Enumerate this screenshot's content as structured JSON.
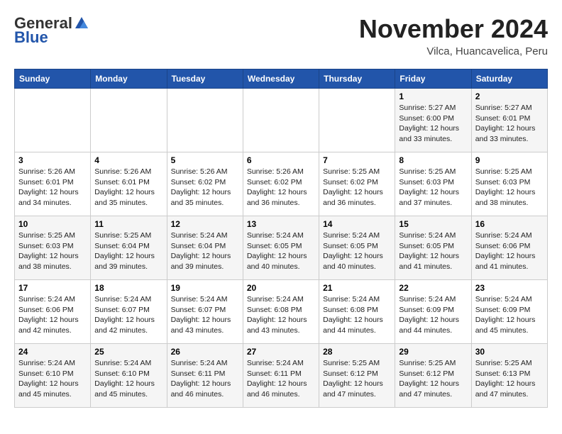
{
  "header": {
    "logo_general": "General",
    "logo_blue": "Blue",
    "month_title": "November 2024",
    "location": "Vilca, Huancavelica, Peru"
  },
  "weekdays": [
    "Sunday",
    "Monday",
    "Tuesday",
    "Wednesday",
    "Thursday",
    "Friday",
    "Saturday"
  ],
  "weeks": [
    [
      {
        "day": "",
        "info": ""
      },
      {
        "day": "",
        "info": ""
      },
      {
        "day": "",
        "info": ""
      },
      {
        "day": "",
        "info": ""
      },
      {
        "day": "",
        "info": ""
      },
      {
        "day": "1",
        "info": "Sunrise: 5:27 AM\nSunset: 6:00 PM\nDaylight: 12 hours and 33 minutes."
      },
      {
        "day": "2",
        "info": "Sunrise: 5:27 AM\nSunset: 6:01 PM\nDaylight: 12 hours and 33 minutes."
      }
    ],
    [
      {
        "day": "3",
        "info": "Sunrise: 5:26 AM\nSunset: 6:01 PM\nDaylight: 12 hours and 34 minutes."
      },
      {
        "day": "4",
        "info": "Sunrise: 5:26 AM\nSunset: 6:01 PM\nDaylight: 12 hours and 35 minutes."
      },
      {
        "day": "5",
        "info": "Sunrise: 5:26 AM\nSunset: 6:02 PM\nDaylight: 12 hours and 35 minutes."
      },
      {
        "day": "6",
        "info": "Sunrise: 5:26 AM\nSunset: 6:02 PM\nDaylight: 12 hours and 36 minutes."
      },
      {
        "day": "7",
        "info": "Sunrise: 5:25 AM\nSunset: 6:02 PM\nDaylight: 12 hours and 36 minutes."
      },
      {
        "day": "8",
        "info": "Sunrise: 5:25 AM\nSunset: 6:03 PM\nDaylight: 12 hours and 37 minutes."
      },
      {
        "day": "9",
        "info": "Sunrise: 5:25 AM\nSunset: 6:03 PM\nDaylight: 12 hours and 38 minutes."
      }
    ],
    [
      {
        "day": "10",
        "info": "Sunrise: 5:25 AM\nSunset: 6:03 PM\nDaylight: 12 hours and 38 minutes."
      },
      {
        "day": "11",
        "info": "Sunrise: 5:25 AM\nSunset: 6:04 PM\nDaylight: 12 hours and 39 minutes."
      },
      {
        "day": "12",
        "info": "Sunrise: 5:24 AM\nSunset: 6:04 PM\nDaylight: 12 hours and 39 minutes."
      },
      {
        "day": "13",
        "info": "Sunrise: 5:24 AM\nSunset: 6:05 PM\nDaylight: 12 hours and 40 minutes."
      },
      {
        "day": "14",
        "info": "Sunrise: 5:24 AM\nSunset: 6:05 PM\nDaylight: 12 hours and 40 minutes."
      },
      {
        "day": "15",
        "info": "Sunrise: 5:24 AM\nSunset: 6:05 PM\nDaylight: 12 hours and 41 minutes."
      },
      {
        "day": "16",
        "info": "Sunrise: 5:24 AM\nSunset: 6:06 PM\nDaylight: 12 hours and 41 minutes."
      }
    ],
    [
      {
        "day": "17",
        "info": "Sunrise: 5:24 AM\nSunset: 6:06 PM\nDaylight: 12 hours and 42 minutes."
      },
      {
        "day": "18",
        "info": "Sunrise: 5:24 AM\nSunset: 6:07 PM\nDaylight: 12 hours and 42 minutes."
      },
      {
        "day": "19",
        "info": "Sunrise: 5:24 AM\nSunset: 6:07 PM\nDaylight: 12 hours and 43 minutes."
      },
      {
        "day": "20",
        "info": "Sunrise: 5:24 AM\nSunset: 6:08 PM\nDaylight: 12 hours and 43 minutes."
      },
      {
        "day": "21",
        "info": "Sunrise: 5:24 AM\nSunset: 6:08 PM\nDaylight: 12 hours and 44 minutes."
      },
      {
        "day": "22",
        "info": "Sunrise: 5:24 AM\nSunset: 6:09 PM\nDaylight: 12 hours and 44 minutes."
      },
      {
        "day": "23",
        "info": "Sunrise: 5:24 AM\nSunset: 6:09 PM\nDaylight: 12 hours and 45 minutes."
      }
    ],
    [
      {
        "day": "24",
        "info": "Sunrise: 5:24 AM\nSunset: 6:10 PM\nDaylight: 12 hours and 45 minutes."
      },
      {
        "day": "25",
        "info": "Sunrise: 5:24 AM\nSunset: 6:10 PM\nDaylight: 12 hours and 45 minutes."
      },
      {
        "day": "26",
        "info": "Sunrise: 5:24 AM\nSunset: 6:11 PM\nDaylight: 12 hours and 46 minutes."
      },
      {
        "day": "27",
        "info": "Sunrise: 5:24 AM\nSunset: 6:11 PM\nDaylight: 12 hours and 46 minutes."
      },
      {
        "day": "28",
        "info": "Sunrise: 5:25 AM\nSunset: 6:12 PM\nDaylight: 12 hours and 47 minutes."
      },
      {
        "day": "29",
        "info": "Sunrise: 5:25 AM\nSunset: 6:12 PM\nDaylight: 12 hours and 47 minutes."
      },
      {
        "day": "30",
        "info": "Sunrise: 5:25 AM\nSunset: 6:13 PM\nDaylight: 12 hours and 47 minutes."
      }
    ]
  ]
}
